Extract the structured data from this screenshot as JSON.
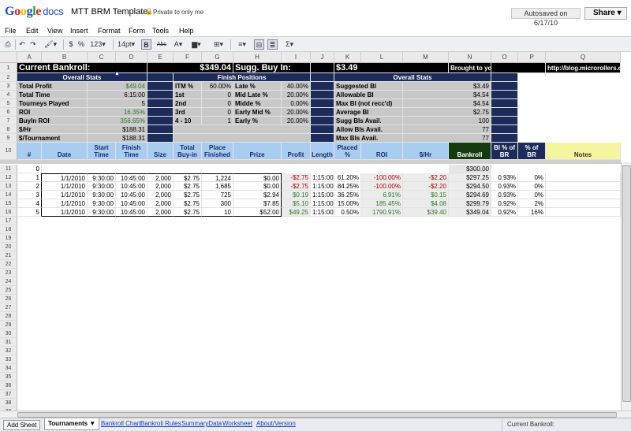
{
  "header": {
    "app_name": "Google docs",
    "doc_title": "MTT BRM Template",
    "privacy": "Private to only me",
    "autosave": "Autosaved on 6/17/10",
    "share_label": "Share"
  },
  "menu": [
    "File",
    "Edit",
    "View",
    "Insert",
    "Format",
    "Form",
    "Tools",
    "Help"
  ],
  "toolbar": {
    "currency": "$",
    "percent": "%",
    "number_format": "123",
    "font_size": "14pt",
    "bold": "B",
    "strike": "Abc",
    "font_color": "A",
    "sigma": "Σ"
  },
  "columns": [
    "A",
    "B",
    "C",
    "D",
    "E",
    "F",
    "G",
    "H",
    "I",
    "J",
    "K",
    "L",
    "M",
    "N",
    "O",
    "P",
    "Q"
  ],
  "rows": [
    "1",
    "2",
    "3",
    "4",
    "5",
    "6",
    "7",
    "8",
    "9",
    "10",
    "11",
    "12",
    "13",
    "14",
    "15",
    "16",
    "17",
    "18",
    "19",
    "20",
    "21",
    "22",
    "23",
    "24",
    "25",
    "26",
    "27",
    "28",
    "29",
    "30",
    "31",
    "32",
    "33",
    "34",
    "35",
    "36",
    "37",
    "38",
    "39",
    "40"
  ],
  "sheet": {
    "current_bankroll_label": "Current Bankroll:",
    "current_bankroll_value": "$349.04",
    "sugg_buyin_label": "Sugg. Buy In:",
    "sugg_buyin_value": "$3.49",
    "brought_by": "Brought to you by",
    "blog_url": "http://blog.microrollers.com",
    "overall_stats_left": "Overall Stats",
    "finish_positions": "Finish Positions",
    "overall_stats_right": "Overall Stats",
    "left_stats": [
      {
        "label": "Total Profit",
        "value": "$49.04"
      },
      {
        "label": "Total Time",
        "value": "6:15:00"
      },
      {
        "label": "Tourneys Played",
        "value": "5"
      },
      {
        "label": "ROI",
        "value": "16.35%"
      },
      {
        "label": "BuyIn ROI",
        "value": "356.65%"
      },
      {
        "label": "$/Hr",
        "value": "$188.31"
      },
      {
        "label": "$/Tournament",
        "value": "$188.31"
      }
    ],
    "finish_stats": [
      {
        "label": "ITM %",
        "value": "60.00%",
        "label2": "Late %",
        "value2": "40.00%"
      },
      {
        "label": "1st",
        "value": "0",
        "label2": "Mid Late %",
        "value2": "20.00%"
      },
      {
        "label": "2nd",
        "value": "0",
        "label2": "Midde %",
        "value2": "0.00%"
      },
      {
        "label": "3rd",
        "value": "0",
        "label2": "Early Mid %",
        "value2": "20.00%"
      },
      {
        "label": "4 - 10",
        "value": "1",
        "label2": "Early %",
        "value2": "20.00%"
      }
    ],
    "right_stats": [
      {
        "label": "Suggested BI",
        "value": "$3.49"
      },
      {
        "label": "Allowable BI",
        "value": "$4.54"
      },
      {
        "label": "Max BI (not recc'd)",
        "value": "$4.54"
      },
      {
        "label": "Average BI",
        "value": "$2.75"
      },
      {
        "label": "Sugg BIs Avail.",
        "value": "100"
      },
      {
        "label": "Allow BIs Avail.",
        "value": "77"
      },
      {
        "label": "Max BIs Avail.",
        "value": "77"
      }
    ],
    "table_headers": {
      "num": "#",
      "date": "Date",
      "start": "Start Time",
      "finish": "Finish Time",
      "size": "Size",
      "buyin": "Total Buy-in",
      "place": "Place Finished",
      "prize": "Prize",
      "profit": "Profit",
      "length": "Length",
      "placed": "Placed %",
      "roi": "ROI",
      "hr": "$/Hr",
      "bankroll": "Bankroll",
      "bipct": "BI % of BR",
      "profitpct": "Profit % of BR",
      "notes": "Notes"
    },
    "row0": {
      "num": "0",
      "bankroll": "$300.00"
    },
    "data_rows": [
      {
        "num": "1",
        "date": "1/1/2010",
        "start": "9:30:00",
        "finish": "10:45:00",
        "size": "2,000",
        "buyin": "$2.75",
        "place": "1,224",
        "prize": "$0.00",
        "profit": "-$2.75",
        "length": "1:15:00",
        "placed": "61.20%",
        "roi": "-100.00%",
        "hr": "-$2.20",
        "bankroll": "$297.25",
        "bipct": "0.93%",
        "profitpct": "0%",
        "sign": "neg"
      },
      {
        "num": "2",
        "date": "1/1/2010",
        "start": "9:30:00",
        "finish": "10:45:00",
        "size": "2,000",
        "buyin": "$2.75",
        "place": "1,685",
        "prize": "$0.00",
        "profit": "-$2.75",
        "length": "1:15:00",
        "placed": "84.25%",
        "roi": "-100.00%",
        "hr": "-$2.20",
        "bankroll": "$294.50",
        "bipct": "0.93%",
        "profitpct": "0%",
        "sign": "neg"
      },
      {
        "num": "3",
        "date": "1/1/2010",
        "start": "9:30:00",
        "finish": "10:45:00",
        "size": "2,000",
        "buyin": "$2.75",
        "place": "725",
        "prize": "$2.94",
        "profit": "$0.19",
        "length": "1:15:00",
        "placed": "36.25%",
        "roi": "6.91%",
        "hr": "$0.15",
        "bankroll": "$294.69",
        "bipct": "0.93%",
        "profitpct": "0%",
        "sign": "pos"
      },
      {
        "num": "4",
        "date": "1/1/2010",
        "start": "9:30:00",
        "finish": "10:45:00",
        "size": "2,000",
        "buyin": "$2.75",
        "place": "300",
        "prize": "$7.85",
        "profit": "$5.10",
        "length": "1:15:00",
        "placed": "15.00%",
        "roi": "185.45%",
        "hr": "$4.08",
        "bankroll": "$299.79",
        "bipct": "0.92%",
        "profitpct": "2%",
        "sign": "pos"
      },
      {
        "num": "5",
        "date": "1/1/2010",
        "start": "9:30:00",
        "finish": "10:45:00",
        "size": "2,000",
        "buyin": "$2.75",
        "place": "10",
        "prize": "$52.00",
        "profit": "$49.25",
        "length": "1:15:00",
        "placed": "0.50%",
        "roi": "1790.91%",
        "hr": "$39.40",
        "bankroll": "$349.04",
        "bipct": "0.92%",
        "profitpct": "16%",
        "sign": "pos"
      }
    ]
  },
  "bottom": {
    "add_sheet": "Add Sheet",
    "tabs": [
      "Tournaments ▼",
      "Bankroll Chart",
      "Bankroll Rules",
      "SummaryData",
      "Worksheet",
      "About/Version"
    ],
    "status": "Current Bankroll:"
  }
}
